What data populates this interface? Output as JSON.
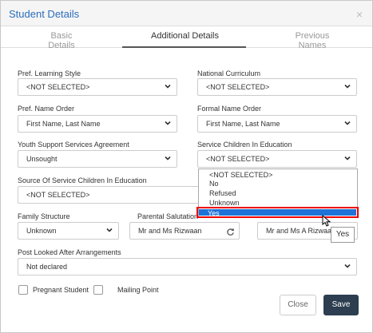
{
  "dialog": {
    "title": "Student Details",
    "close_glyph": "×"
  },
  "tabs": [
    {
      "label": "Basic Details"
    },
    {
      "label": "Additional Details"
    },
    {
      "label": "Previous Names"
    }
  ],
  "fields": {
    "pref_learning_style": {
      "label": "Pref. Learning Style",
      "value": "<NOT SELECTED>"
    },
    "national_curriculum": {
      "label": "National Curriculum",
      "value": "<NOT SELECTED>"
    },
    "pref_name_order": {
      "label": "Pref. Name Order",
      "value": "First Name, Last Name"
    },
    "formal_name_order": {
      "label": "Formal Name Order",
      "value": "First Name, Last Name"
    },
    "youth_support": {
      "label": "Youth Support Services Agreement",
      "value": "Unsought"
    },
    "service_children": {
      "label": "Service Children In Education",
      "value": "<NOT SELECTED>"
    },
    "source_service_children": {
      "label": "Source Of Service Children In Education",
      "value": "<NOT SELECTED>"
    },
    "family_structure": {
      "label": "Family Structure",
      "value": "Unknown"
    },
    "parental_salutation": {
      "label": "Parental Salutation",
      "value": "Mr and Ms Rizwaan"
    },
    "parental_addressee": {
      "value": "Mr and Ms A Rizwaan"
    },
    "post_looked_after": {
      "label": "Post Looked After Arrangements",
      "value": "Not declared"
    }
  },
  "dropdown": {
    "options": [
      "<NOT SELECTED>",
      "No",
      "Refused",
      "Unknown",
      "Yes"
    ],
    "highlighted": "Yes"
  },
  "tooltip": "Yes",
  "checkboxes": {
    "pregnant_student": "Pregnant Student",
    "mailing_point": "Mailing Point"
  },
  "buttons": {
    "close": "Close",
    "save": "Save"
  },
  "colors": {
    "title": "#2a6ebb",
    "highlight": "#1e73d8",
    "highlight_border": "#e00000",
    "save_bg": "#2c3e50"
  }
}
